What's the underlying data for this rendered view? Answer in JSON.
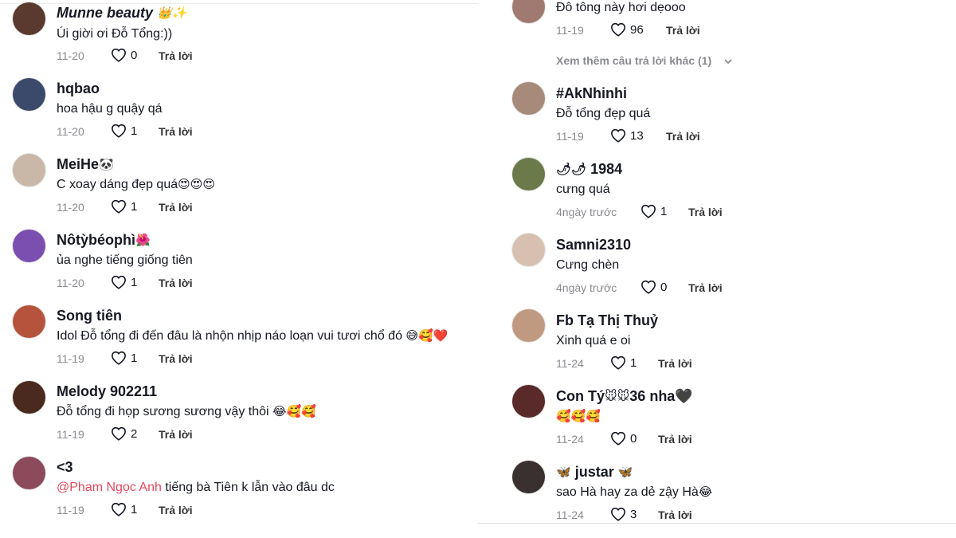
{
  "left_comments": [
    {
      "username": "Munne beauty",
      "username_emoji": "👑✨",
      "text": "Úi giời ơi Đỗ Tổng:))",
      "date": "11-20",
      "likes": "0",
      "reply": "Trả lời",
      "avatar_color": "#5a3a2e"
    },
    {
      "username": "hqbao",
      "username_emoji": "",
      "text": "hoa hậu g quậy qá",
      "date": "11-20",
      "likes": "1",
      "reply": "Trả lời",
      "avatar_color": "#3b4a6b"
    },
    {
      "username": "MeiHe",
      "username_emoji": "🐼",
      "text": "C xoay dáng đẹp quá",
      "text_emoji": "😍😍😍",
      "date": "11-20",
      "likes": "1",
      "reply": "Trả lời",
      "avatar_color": "#c9b7a8"
    },
    {
      "username": "Nôtỳbéophì",
      "username_emoji": "🌺",
      "text": "ủa nghe tiếng giống tiên",
      "date": "11-20",
      "likes": "1",
      "reply": "Trả lời",
      "avatar_color": "#7b4fb0"
    },
    {
      "username": "Song tiên",
      "username_emoji": "",
      "text": "Idol Đỗ tổng đi đến đâu là nhộn nhịp náo loạn vui tươi chổ đó",
      "text_emoji": "😅🥰❤️",
      "date": "11-19",
      "likes": "1",
      "reply": "Trả lời",
      "avatar_color": "#b5533c"
    },
    {
      "username": "Melody 902211",
      "username_emoji": "",
      "text": "Đỗ tổng đi họp sương sương vậy thôi",
      "text_emoji": "😂🥰🥰",
      "date": "11-19",
      "likes": "2",
      "reply": "Trả lời",
      "avatar_color": "#4a2a1e"
    },
    {
      "username": "<3",
      "username_emoji": "",
      "mention": "@Pham Ngọc Anh",
      "text": " tiếng bà Tiên k lẫn vào đâu dc",
      "date": "11-19",
      "likes": "1",
      "reply": "Trả lời",
      "avatar_color": "#8c4a5a"
    }
  ],
  "right_top": {
    "text": "Đô tông này hơi dẹooo",
    "date": "11-19",
    "likes": "96",
    "reply": "Trả lời",
    "view_more": "Xem thêm câu trả lời khác (1)"
  },
  "right_comments": [
    {
      "username": "#AkNhinhi",
      "username_emoji": "",
      "text": "Đỗ tổng đẹp quá",
      "date": "11-19",
      "likes": "13",
      "reply": "Trả lời",
      "avatar_color": "#a88a7a"
    },
    {
      "username": "1984",
      "username_emoji": "🌶🌶",
      "text": "cưng quá",
      "date": "4ngày trước",
      "likes": "1",
      "reply": "Trả lời",
      "avatar_color": "#6b7a4a"
    },
    {
      "username": "Samni2310",
      "username_emoji": "",
      "text": "Cưng chèn",
      "date": "4ngày trước",
      "likes": "0",
      "reply": "Trả lời",
      "avatar_color": "#d8c0b0"
    },
    {
      "username": "Fb Tạ Thị Thuỷ",
      "username_emoji": "",
      "text": "Xinh quá e oi",
      "date": "11-24",
      "likes": "1",
      "reply": "Trả lời",
      "avatar_color": "#c09a80"
    },
    {
      "username": "Con Tý",
      "username_emoji": "🐭🐭",
      "username_suffix": "36 nha🖤",
      "text": "",
      "text_emoji": "🥰🥰🥰",
      "date": "11-24",
      "likes": "0",
      "reply": "Trả lời",
      "avatar_color": "#5a2a2a"
    },
    {
      "username": "justar",
      "username_emoji": "🦋",
      "username_emoji_after": "🦋",
      "text": "sao Hà hay za dẻ zậy Hà",
      "text_emoji": "😂",
      "date": "11-24",
      "likes": "3",
      "reply": "Trả lời",
      "avatar_color": "#3a3030"
    }
  ]
}
